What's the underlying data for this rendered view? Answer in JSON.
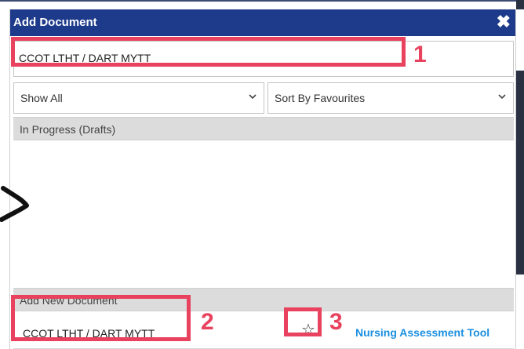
{
  "dialog": {
    "title": "Add Document",
    "close_glyph": "✖"
  },
  "search": {
    "value": "CCOT LTHT / DART MYTT"
  },
  "filters": {
    "show": {
      "selected": "Show All"
    },
    "sort": {
      "selected": "Sort By Favourites"
    }
  },
  "drafts": {
    "header": "In Progress (Drafts)"
  },
  "new_document": {
    "header": "Add New Document",
    "row": {
      "title": "CCOT LTHT / DART MYTT",
      "link": "Nursing Assessment Tool"
    }
  },
  "annotations": {
    "one": "1",
    "two": "2",
    "three": "3",
    "color": "#e8425f"
  },
  "colors": {
    "titlebar": "#1e3a8a",
    "section_header": "#dcdcdc",
    "link": "#1a8fe0"
  }
}
